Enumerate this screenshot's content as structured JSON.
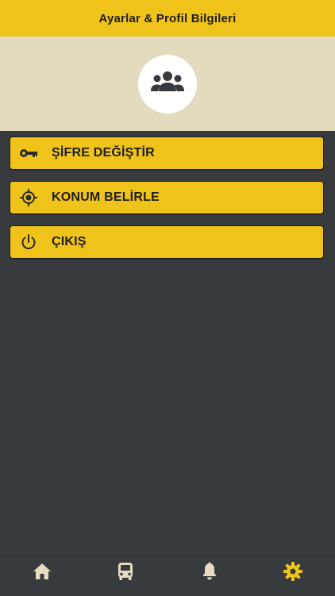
{
  "header": {
    "title": "Ayarlar & Profil Bilgileri"
  },
  "profile": {
    "avatar_icon": "people-group-icon"
  },
  "menu": {
    "items": [
      {
        "label": "ŞİFRE DEĞİŞTİR",
        "icon": "key-icon"
      },
      {
        "label": "KONUM BELİRLE",
        "icon": "location-target-icon"
      },
      {
        "label": "ÇIKIŞ",
        "icon": "power-icon"
      }
    ]
  },
  "bottom_nav": {
    "items": [
      {
        "icon": "home-icon",
        "active": false
      },
      {
        "icon": "bus-icon",
        "active": false
      },
      {
        "icon": "bell-icon",
        "active": false
      },
      {
        "icon": "gear-icon",
        "active": true
      }
    ]
  },
  "colors": {
    "accent": "#f0c31a",
    "background": "#383b3e",
    "profile_band": "#e2dbbe",
    "nav_inactive": "#e6dcc0"
  }
}
